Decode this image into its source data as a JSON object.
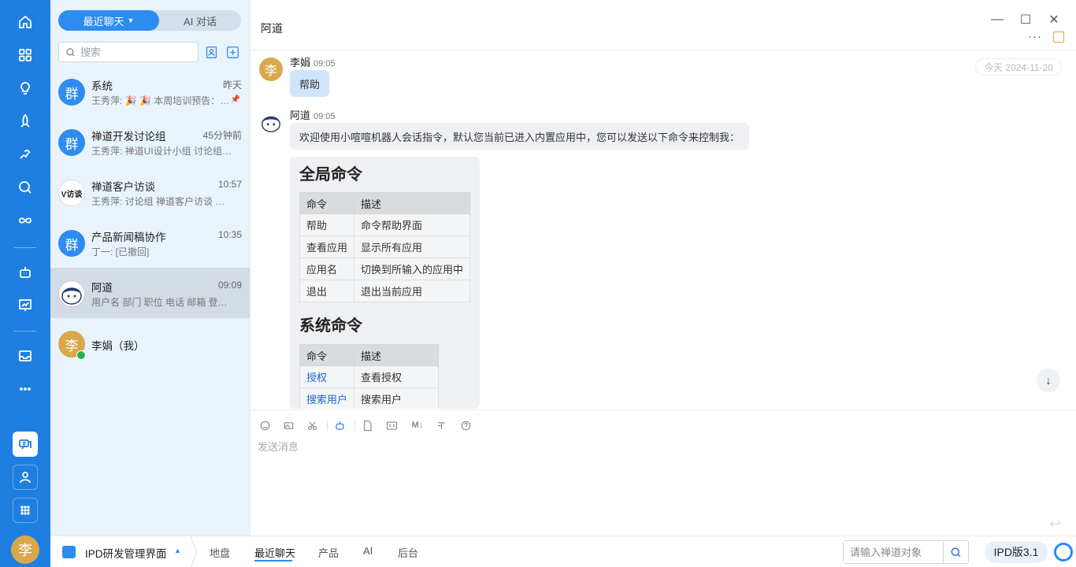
{
  "sidebar": {
    "items": [
      {
        "icon": "home-icon"
      },
      {
        "icon": "grid-icon"
      },
      {
        "icon": "lightbulb-icon"
      },
      {
        "icon": "rocket-icon"
      },
      {
        "icon": "runner-icon"
      },
      {
        "icon": "search-icon"
      },
      {
        "icon": "infinity-icon"
      },
      {
        "icon": "robot-icon"
      },
      {
        "icon": "chart-board-icon"
      },
      {
        "icon": "inbox-icon"
      },
      {
        "icon": "more-icon"
      },
      {
        "icon": "chat-icon"
      },
      {
        "icon": "contacts-icon"
      },
      {
        "icon": "apps-icon"
      }
    ],
    "user_avatar": "李"
  },
  "list": {
    "tabs": {
      "recent": "最近聊天",
      "ai": "AI 对话"
    },
    "search_placeholder": "搜索",
    "conversations": [
      {
        "name": "系统",
        "time": "昨天",
        "preview": "王秀萍: 🎉 🎉 本周培训预告：…",
        "avatar": "群",
        "pinned": true
      },
      {
        "name": "禅道开发讨论组",
        "time": "45分钟前",
        "preview": "王秀萍: 禅道UI设计小组 讨论组…",
        "avatar": "群"
      },
      {
        "name": "禅道客户访谈",
        "time": "10:57",
        "preview": "王秀萍: 讨论组 禅道客户访谈 所…",
        "avatar": "V访谈"
      },
      {
        "name": "产品新闻稿协作",
        "time": "10:35",
        "preview": "丁一: [已撤回]",
        "avatar": "群"
      },
      {
        "name": "阿道",
        "time": "09:09",
        "preview": "用户名 部门 职位 电话 邮箱 登录…",
        "avatar": ""
      },
      {
        "name": "李娟（我）",
        "time": "",
        "preview": "",
        "avatar": "李"
      }
    ]
  },
  "chat": {
    "title": "阿道",
    "date": "今天 2024-11-20",
    "msg1": {
      "name": "李娟",
      "time": "09:05",
      "avatar": "李",
      "text": "帮助"
    },
    "msg2": {
      "name": "阿道",
      "time": "09:05",
      "text": "欢迎使用小喧喧机器人会话指令，默认您当前已进入内置应用中，您可以发送以下命令来控制我："
    },
    "card": {
      "global_title": "全局命令",
      "headers": [
        "命令",
        "描述"
      ],
      "global_rows": [
        [
          "帮助",
          "命令帮助界面"
        ],
        [
          "查看应用",
          "显示所有应用"
        ],
        [
          "应用名",
          "切换到所输入的应用中"
        ],
        [
          "退出",
          "退出当前应用"
        ]
      ],
      "system_title": "系统命令",
      "system_rows": [
        [
          "授权",
          "查看授权"
        ],
        [
          "搜索用户",
          "搜索用户"
        ]
      ]
    },
    "composer_placeholder": "发送消息",
    "toolbar": [
      "emoji-icon",
      "image-icon",
      "scissors-icon",
      "robot-icon",
      "file-icon",
      "code-icon",
      "markdown-icon",
      "text-format-icon",
      "help-icon"
    ]
  },
  "bottom": {
    "workspace": "IPD研发管理界面",
    "tabs": [
      "地盘",
      "最近聊天",
      "产品",
      "AI",
      "后台"
    ],
    "active_tab": "最近聊天",
    "search_placeholder": "请输入禅道对象",
    "version": "IPD版3.1"
  },
  "colors": {
    "accent": "#2d8cf0",
    "rail": "#1e7fe0",
    "list_bg": "#e9f3fc",
    "bubble_me": "#cfe5fb"
  }
}
